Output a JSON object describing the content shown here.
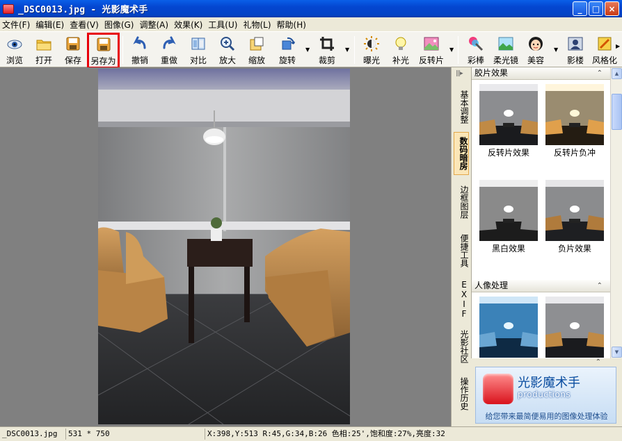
{
  "window": {
    "title": "_DSC0013.jpg - 光影魔术手",
    "buttons": {
      "minimize": "_",
      "maximize": "□",
      "close": "×"
    }
  },
  "menu": [
    "文件(F)",
    "编辑(E)",
    "查看(V)",
    "图像(G)",
    "调整(A)",
    "效果(K)",
    "工具(U)",
    "礼物(L)",
    "帮助(H)"
  ],
  "toolbar": {
    "browse": "浏览",
    "open": "打开",
    "save": "保存",
    "save_as": "另存为",
    "undo": "撤销",
    "redo": "重做",
    "compare": "对比",
    "zoom_in": "放大",
    "zoom_out": "缩放",
    "rotate": "旋转",
    "crop": "裁剪",
    "exposure": "曝光",
    "fill_light": "补光",
    "reverse_film": "反转片",
    "color_pen": "彩棒",
    "soft_focus": "柔光镜",
    "beauty": "美容",
    "studio": "影楼",
    "style": "风格化"
  },
  "side_tabs": [
    "基本调整",
    "数码暗房",
    "边框图层",
    "便捷工具",
    "EXIF",
    "光影社区",
    "操作历史"
  ],
  "side_tabs_active": "数码暗房",
  "panel": {
    "sections": [
      {
        "title": "胶片效果",
        "items": [
          "反转片效果",
          "反转片负冲",
          "黑白效果",
          "负片效果"
        ]
      },
      {
        "title": "人像处理",
        "items": [
          "",
          ""
        ]
      }
    ]
  },
  "ad": {
    "title": "光影魔术手",
    "subtitle": "productions",
    "tagline": "给您带来最简便易用的图像处理体验"
  },
  "status": {
    "filename": "_DSC0013.jpg",
    "dimensions": "531 * 750",
    "pixel_info": "X:398,Y:513 R:45,G:34,B:26 色相:25',饱和度:27%,亮度:32"
  },
  "colors": {
    "title_bar": "#0446d0",
    "highlight_border": "#e8000a",
    "canvas_bg": "#808080",
    "active_tab": "#fbe6b7"
  }
}
